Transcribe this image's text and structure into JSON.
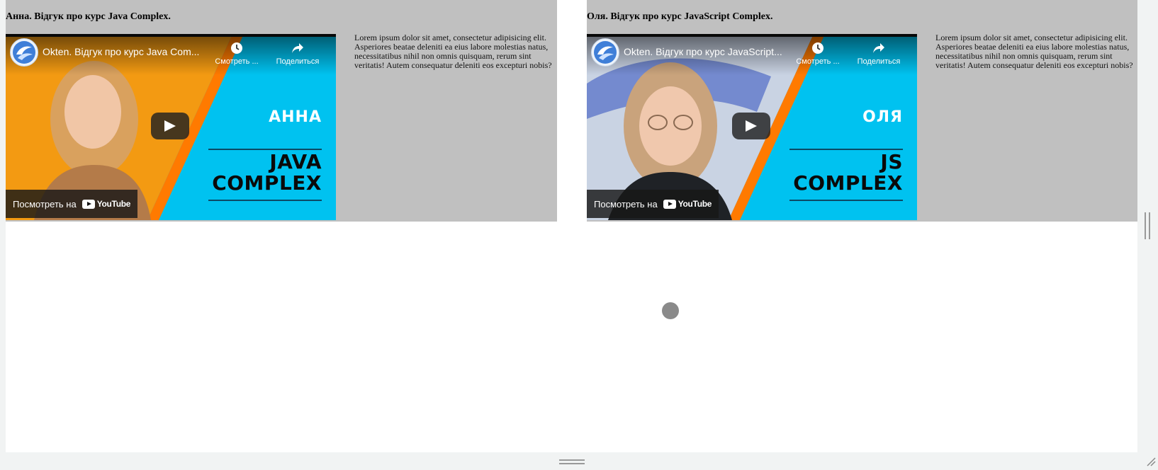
{
  "videos": [
    {
      "heading": "Анна. Відгук про курс Java Complex.",
      "video_title": "Okten. Відгук про курс Java Com...",
      "watch_later_label": "Смотреть ...",
      "share_label": "Поделиться",
      "name_overlay": "АННА",
      "course_line1": "JAVA",
      "course_line2": "COMPLEX",
      "watch_on_label": "Посмотреть на",
      "youtube_label": "YouTube",
      "description": "Lorem ipsum dolor sit amet, consectetur adipisicing elit. Asperiores beatae deleniti ea eius labore molestias natus, necessitatibus nihil non omnis quisquam, rerum sint veritatis! Autem consequatur deleniti eos excepturi nobis?"
    },
    {
      "heading": "Оля. Відгук про курс JavaScript Complex.",
      "video_title": "Okten. Відгук про курс JavaScript...",
      "watch_later_label": "Смотреть ...",
      "share_label": "Поделиться",
      "name_overlay": "ОЛЯ",
      "course_line1": "JS",
      "course_line2": "COMPLEX",
      "watch_on_label": "Посмотреть на",
      "youtube_label": "YouTube",
      "description": "Lorem ipsum dolor sit amet, consectetur adipisicing elit. Asperiores beatae deleniti ea eius labore molestias natus, necessitatibus nihil non omnis quisquam, rerum sint veritatis! Autem consequatur deleniti eos excepturi nobis?"
    }
  ],
  "colors": {
    "card_background": "#c0c0c0",
    "thumbnail_cyan": "#00c2f0",
    "thumbnail_orange": "#f39a12",
    "accent_orange_stripe": "#ff7a00"
  },
  "icons": [
    "channel-logo-icon",
    "clock-icon",
    "share-arrow-icon",
    "play-icon",
    "youtube-logo-icon",
    "loading-spinner-icon",
    "resize-grip-icon"
  ]
}
